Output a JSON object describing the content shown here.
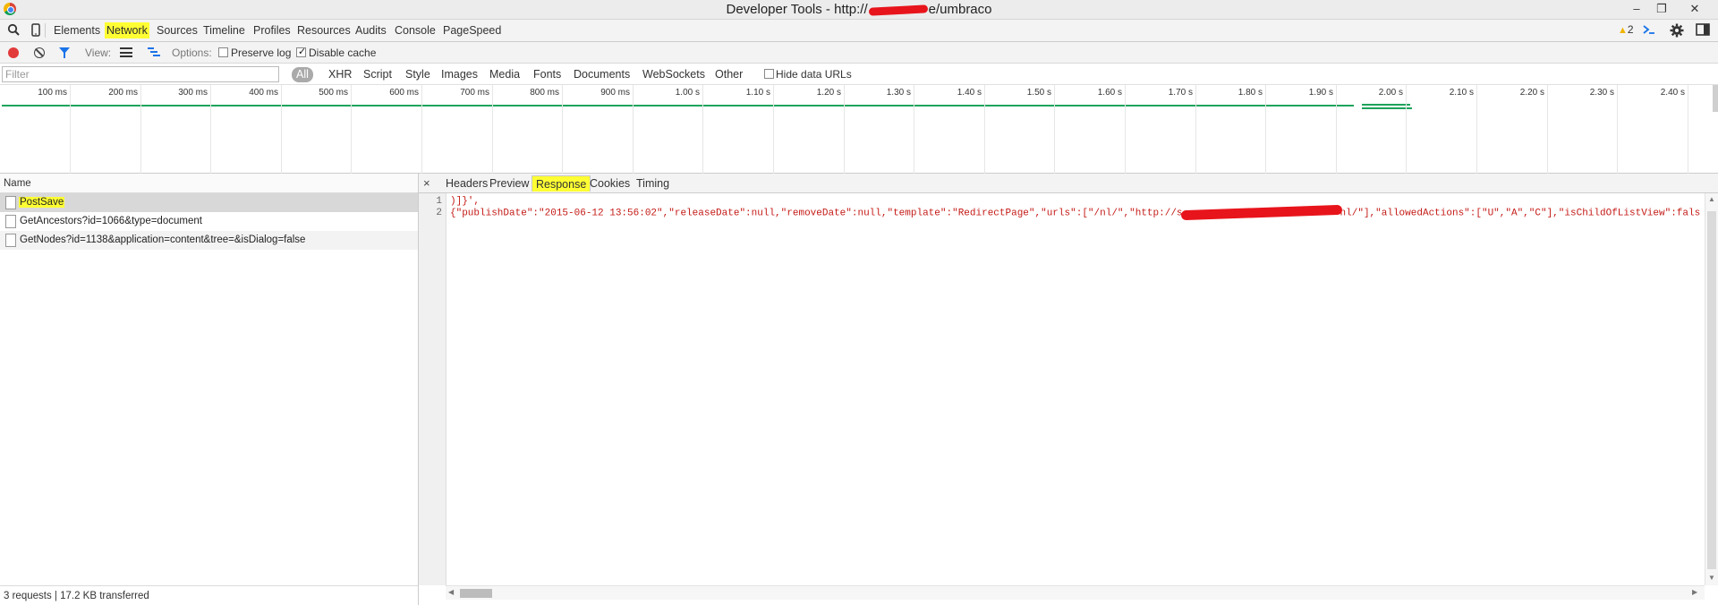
{
  "window": {
    "title_prefix": "Developer Tools - http://",
    "title_suffix": "e/umbraco",
    "controls": {
      "minimize": "–",
      "restore": "❐",
      "close": "✕"
    }
  },
  "main_toolbar": {
    "panels": [
      "Elements",
      "Network",
      "Sources",
      "Timeline",
      "Profiles",
      "Resources",
      "Audits",
      "Console",
      "PageSpeed"
    ],
    "active_panel": "Network",
    "warning_count": "2"
  },
  "network_toolbar": {
    "view_label": "View:",
    "options_label": "Options:",
    "preserve_log": {
      "label": "Preserve log",
      "checked": false
    },
    "disable_cache": {
      "label": "Disable cache",
      "checked": true
    }
  },
  "filter_bar": {
    "placeholder": "Filter",
    "types": [
      "All",
      "XHR",
      "Script",
      "Style",
      "Images",
      "Media",
      "Fonts",
      "Documents",
      "WebSockets",
      "Other"
    ],
    "active_type": "All",
    "hide_data_urls": {
      "label": "Hide data URLs",
      "checked": false
    }
  },
  "timeline": {
    "ticks": [
      "100 ms",
      "200 ms",
      "300 ms",
      "400 ms",
      "500 ms",
      "600 ms",
      "700 ms",
      "800 ms",
      "900 ms",
      "1.00 s",
      "1.10 s",
      "1.20 s",
      "1.30 s",
      "1.40 s",
      "1.50 s",
      "1.60 s",
      "1.70 s",
      "1.80 s",
      "1.90 s",
      "2.00 s",
      "2.10 s",
      "2.20 s",
      "2.30 s",
      "2.40 s"
    ],
    "bar_color": "#1da35b"
  },
  "requests": {
    "column_name": "Name",
    "rows": [
      {
        "name": "PostSave"
      },
      {
        "name": "GetAncestors?id=1066&type=document"
      },
      {
        "name": "GetNodes?id=1138&application=content&tree=&isDialog=false"
      }
    ],
    "selected_index": 0,
    "status": "3 requests  |  17.2 KB transferred"
  },
  "details": {
    "close_icon": "×",
    "tabs": [
      "Headers",
      "Preview",
      "Response",
      "Cookies",
      "Timing"
    ],
    "active_tab": "Response",
    "lines": [
      {
        "number": "1",
        "text": ")]}',"
      },
      {
        "number": "2",
        "part_a": "{\"publishDate\":\"2015-06-12 13:56:02\",\"releaseDate\":null,\"removeDate\":null,\"template\":\"RedirectPage\",\"urls\":[\"/nl/\",\"http://s",
        "part_b": "nl/\"],\"allowedActions\":[\"U\",\"A\",\"C\"],\"isChildOfListView\":fals"
      }
    ]
  },
  "colors": {
    "highlight": "#ffff33",
    "record": "#e23b3b",
    "json_string": "#c41a16",
    "accent_blue": "#1a73e8"
  }
}
